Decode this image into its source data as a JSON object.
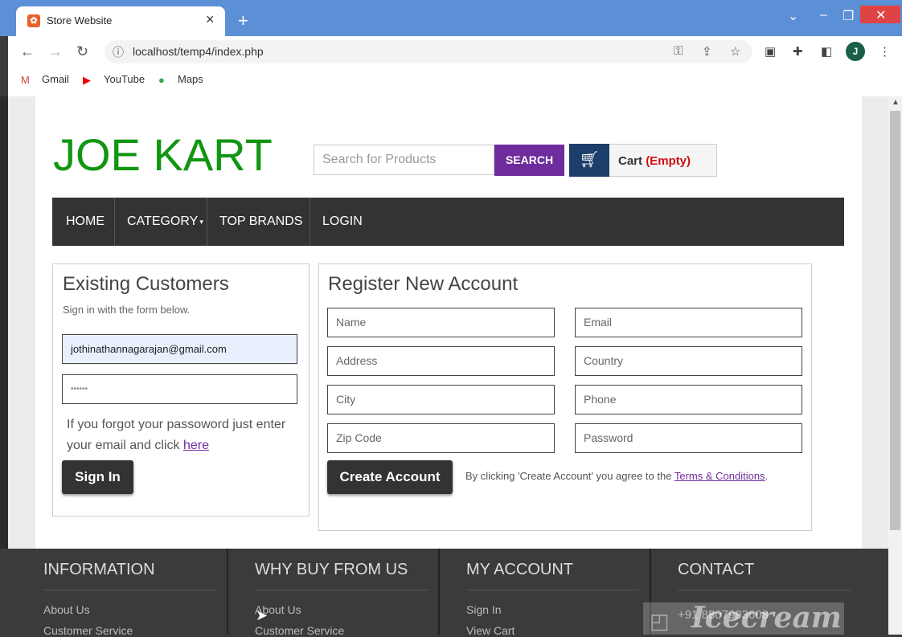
{
  "browser": {
    "tab_title": "Store Website",
    "new_tab": "+",
    "url": "localhost/temp4/index.php",
    "avatar_letter": "J",
    "bookmarks": [
      {
        "label": "Gmail",
        "icon": "gmail-icon"
      },
      {
        "label": "YouTube",
        "icon": "youtube-icon"
      },
      {
        "label": "Maps",
        "icon": "maps-icon"
      }
    ]
  },
  "header": {
    "logo": "JOE KART",
    "search_placeholder": "Search for Products",
    "search_button": "SEARCH",
    "cart_label": "Cart",
    "cart_status": "(Empty)"
  },
  "nav": {
    "items": [
      "HOME",
      "CATEGORY",
      "TOP BRANDS",
      "LOGIN"
    ]
  },
  "login": {
    "title": "Existing Customers",
    "subtitle": "Sign in with the form below.",
    "email_value": "jothinathannagarajan@gmail.com",
    "password_value": "••••••",
    "forgot_text": "If you forgot your passoword just enter your email and click",
    "forgot_link": "here",
    "sign_in_button": "Sign In"
  },
  "register": {
    "title": "Register New Account",
    "fields": {
      "name": "Name",
      "email": "Email",
      "address": "Address",
      "country": "Country",
      "city": "City",
      "phone": "Phone",
      "zip": "Zip Code",
      "password": "Password"
    },
    "create_button": "Create Account",
    "terms_prefix": "By clicking 'Create Account' you agree to the",
    "terms_link": "Terms & Conditions",
    "terms_suffix": "."
  },
  "footer": {
    "columns": [
      {
        "heading": "INFORMATION",
        "links": [
          "About Us",
          "Customer Service"
        ]
      },
      {
        "heading": "WHY BUY FROM US",
        "links": [
          "About Us",
          "Customer Service"
        ]
      },
      {
        "heading": "MY ACCOUNT",
        "links": [
          "Sign In",
          "View Cart"
        ]
      },
      {
        "heading": "CONTACT",
        "links": [
          "+91 8807993608"
        ]
      }
    ]
  },
  "watermark": "Icecream"
}
